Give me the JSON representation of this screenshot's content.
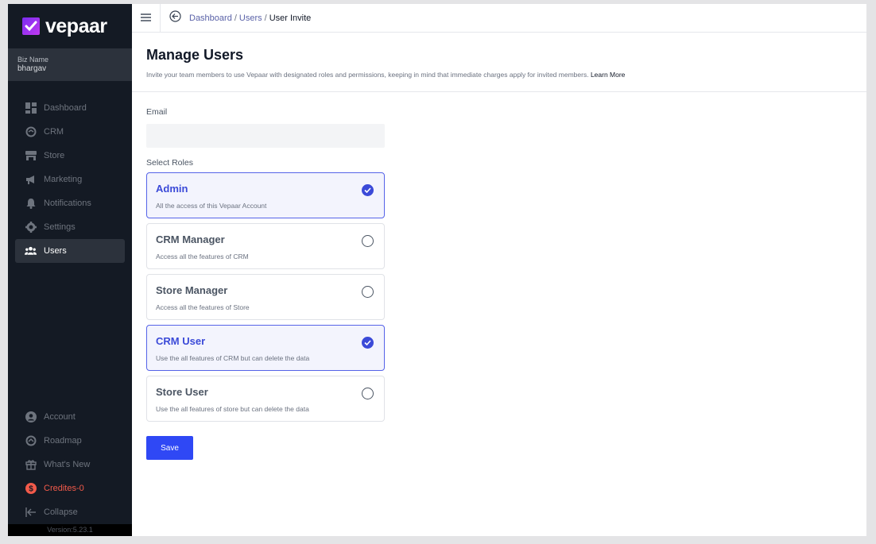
{
  "brand": {
    "name": "vepaar"
  },
  "biz": {
    "label": "Biz Name",
    "name": "bhargav"
  },
  "sidebar": {
    "items": [
      {
        "label": "Dashboard",
        "icon": "dashboard-icon"
      },
      {
        "label": "CRM",
        "icon": "crm-icon"
      },
      {
        "label": "Store",
        "icon": "store-icon"
      },
      {
        "label": "Marketing",
        "icon": "megaphone-icon"
      },
      {
        "label": "Notifications",
        "icon": "bell-icon"
      },
      {
        "label": "Settings",
        "icon": "gear-icon"
      },
      {
        "label": "Users",
        "icon": "users-icon",
        "active": true
      }
    ],
    "bottom": [
      {
        "label": "Account",
        "icon": "account-icon"
      },
      {
        "label": "Roadmap",
        "icon": "roadmap-icon"
      },
      {
        "label": "What's New",
        "icon": "gift-icon"
      },
      {
        "label": "Credites-0",
        "icon": "credit-icon"
      },
      {
        "label": "Collapse",
        "icon": "collapse-icon"
      }
    ],
    "version": "Version:5.23.1"
  },
  "breadcrumb": {
    "items": [
      "Dashboard",
      "Users"
    ],
    "current": "User Invite"
  },
  "page": {
    "title": "Manage Users",
    "subtitle": "Invite your team members to use Vepaar with designated roles and permissions, keeping in mind that immediate charges apply for invited members.",
    "learn_more": "Learn More"
  },
  "form": {
    "email_label": "Email",
    "email_value": "",
    "roles_label": "Select Roles",
    "roles": [
      {
        "name": "Admin",
        "desc": "All the access of this Vepaar Account",
        "selected": true
      },
      {
        "name": "CRM Manager",
        "desc": "Access all the features of CRM",
        "selected": false
      },
      {
        "name": "Store Manager",
        "desc": "Access all the features of Store",
        "selected": false
      },
      {
        "name": "CRM User",
        "desc": "Use the all features of CRM but can delete the data",
        "selected": true
      },
      {
        "name": "Store User",
        "desc": "Use the all features of store but can delete the data",
        "selected": false
      }
    ],
    "save_label": "Save"
  },
  "colors": {
    "accent": "#3b4ad8",
    "sidebar_bg": "#141a24",
    "credit": "#f25a4a"
  }
}
